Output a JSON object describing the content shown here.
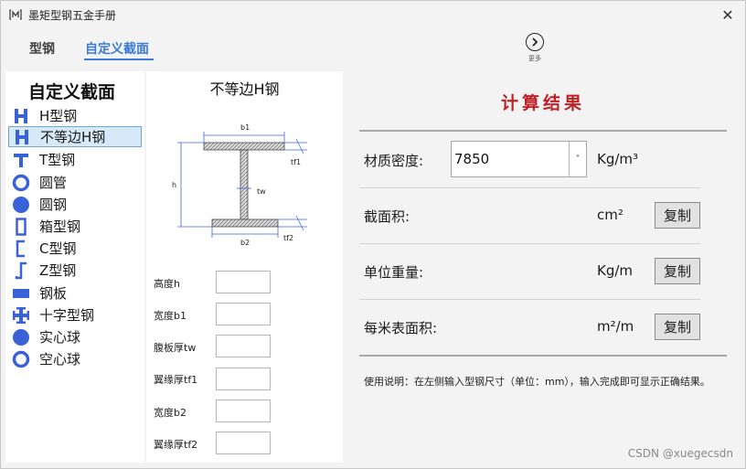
{
  "window": {
    "title": "墨矩型钢五金手册",
    "close_glyph": "✕"
  },
  "tabs": [
    {
      "label": "型钢",
      "active": false
    },
    {
      "label": "自定义截面",
      "active": true
    }
  ],
  "more": {
    "label": "更多"
  },
  "left": {
    "title": "自定义截面",
    "items": [
      {
        "label": "H型钢",
        "icon": "h-beam-icon"
      },
      {
        "label": "不等边H钢",
        "icon": "unequal-h-beam-icon",
        "selected": true
      },
      {
        "label": "T型钢",
        "icon": "t-beam-icon"
      },
      {
        "label": "圆管",
        "icon": "round-tube-icon"
      },
      {
        "label": "圆钢",
        "icon": "round-bar-icon"
      },
      {
        "label": "箱型钢",
        "icon": "box-section-icon"
      },
      {
        "label": "C型钢",
        "icon": "c-channel-icon"
      },
      {
        "label": "Z型钢",
        "icon": "z-section-icon"
      },
      {
        "label": "钢板",
        "icon": "steel-plate-icon"
      },
      {
        "label": "十字型钢",
        "icon": "cross-section-icon"
      },
      {
        "label": "实心球",
        "icon": "solid-sphere-icon"
      },
      {
        "label": "空心球",
        "icon": "hollow-sphere-icon"
      }
    ]
  },
  "middle": {
    "title": "不等边H钢",
    "diagram_labels": {
      "b1": "b1",
      "b2": "b2",
      "h": "h",
      "tw": "tw",
      "tf1": "tf1",
      "tf2": "tf2"
    },
    "fields": [
      {
        "label": "高度h",
        "value": ""
      },
      {
        "label": "宽度b1",
        "value": ""
      },
      {
        "label": "腹板厚tw",
        "value": ""
      },
      {
        "label": "翼缘厚tf1",
        "value": ""
      },
      {
        "label": "宽度b2",
        "value": ""
      },
      {
        "label": "翼缘厚tf2",
        "value": ""
      }
    ]
  },
  "right": {
    "title": "计算结果",
    "density": {
      "label": "材质密度:",
      "value": "7850",
      "unit": "Kg/m³",
      "arrow": "˅"
    },
    "rows": [
      {
        "label": "截面积:",
        "unit": "cm²",
        "copy": "复制"
      },
      {
        "label": "单位重量:",
        "unit": "Kg/m",
        "copy": "复制"
      },
      {
        "label": "每米表面积:",
        "unit": "m²/m",
        "copy": "复制"
      }
    ],
    "note": "使用说明：在左侧输入型钢尺寸（单位：mm），输入完成即可显示正确结果。"
  },
  "watermark": "CSDN @xuegecsdn",
  "colors": {
    "accent": "#3a7ad8",
    "result_title": "#c02026",
    "icon_blue": "#3a62d8",
    "selection": "#d7e9f7"
  }
}
